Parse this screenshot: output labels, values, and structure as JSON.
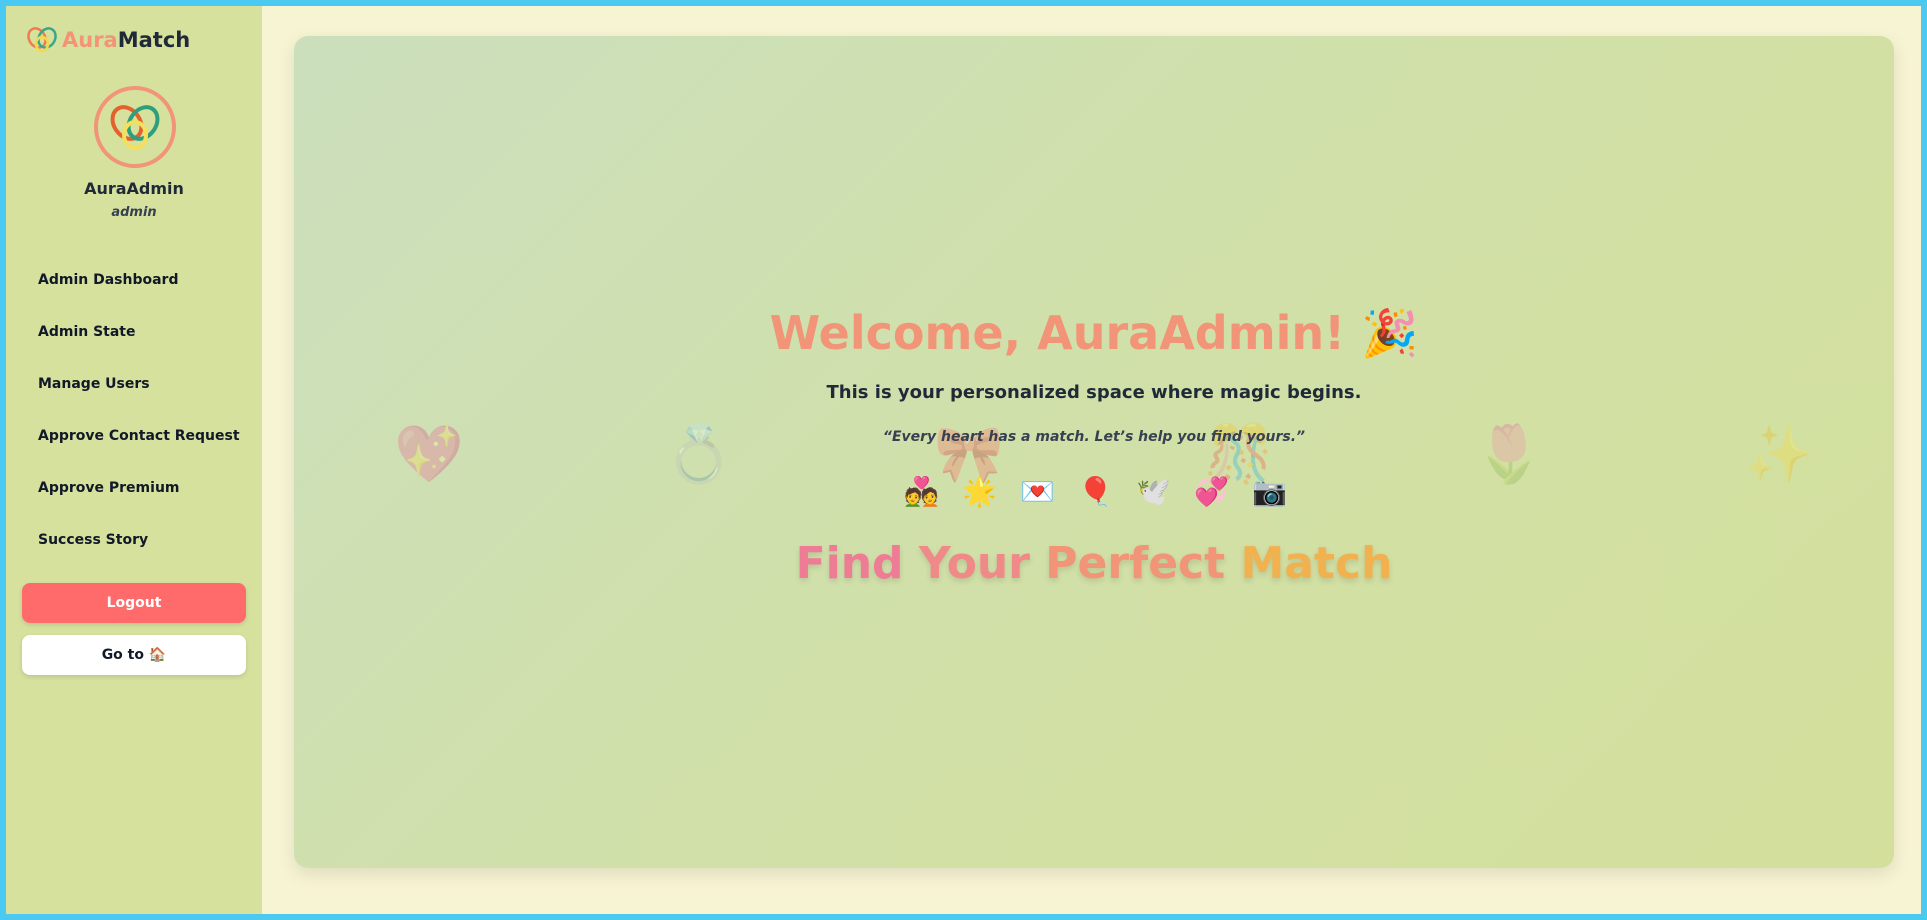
{
  "sidebar": {
    "brand": {
      "part1": "Aura",
      "part2": "Match"
    },
    "profile": {
      "name": "AuraAdmin",
      "role": "admin"
    },
    "nav": [
      {
        "label": "Admin Dashboard"
      },
      {
        "label": "Admin State"
      },
      {
        "label": "Manage Users"
      },
      {
        "label": "Approve Contact Request"
      },
      {
        "label": "Approve Premium"
      },
      {
        "label": "Success Story"
      }
    ],
    "logout_label": "Logout",
    "goto_label": "Go to 🏠"
  },
  "main": {
    "welcome": "Welcome, AuraAdmin! 🎉",
    "subtitle": "This is your personalized space where magic begins.",
    "quote": "“Every heart has a match. Let’s help you find yours.”",
    "emojis": [
      "💑",
      "🌟",
      "💌",
      "🎈",
      "🕊️",
      "💞",
      "📷"
    ],
    "tagline": {
      "w1": "Find",
      "w2": "Your",
      "w3": "Perfect",
      "w4": "Match"
    },
    "background_emojis": [
      "💖",
      "💍",
      "🎀",
      "🎊",
      "🌷",
      "✨"
    ]
  },
  "colors": {
    "sidebar_bg": "#d6e19e",
    "accent": "#f29477",
    "logout_bg": "#ff6b6b",
    "frame_border": "#4cc9f0"
  }
}
